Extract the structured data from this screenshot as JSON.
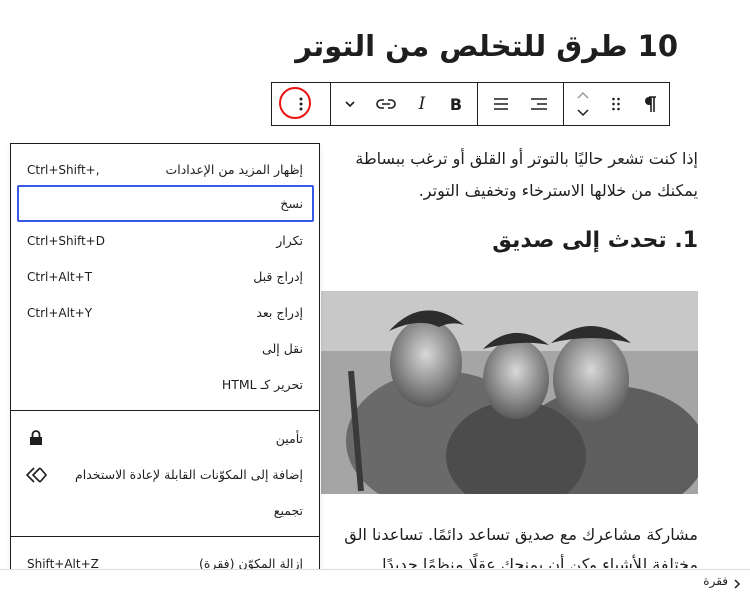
{
  "title": "10 طرق للتخلص من التوتر",
  "toolbar": {
    "paragraph_icon": "paragraph-icon",
    "drag_icon": "drag-handle-icon",
    "move_icon": "move-up-down-icon",
    "align_icon": "align-right-icon",
    "justify_icon": "justify-icon",
    "bold_label": "B",
    "italic_label": "I",
    "link_icon": "link-icon",
    "more_icon": "chevron-down-icon",
    "options_icon": "more-vertical-icon"
  },
  "content": {
    "para1_line1": "إذا كنت تشعر حاليًا بالتوتر أو القلق أو ترغب ببساطة",
    "para1_line2": "يمكنك من خلالها الاسترخاء وتخفيف التوتر.",
    "subheading": "1. تحدث إلى صديق",
    "para2_line1": "مشاركة مشاعرك مع صديق تساعد دائمًا. تساعدنا الق",
    "para2_line2": "مختلفة للأشياء وكن أن يمنحك عقلًا منظمًا جديدًا."
  },
  "menu": {
    "items": [
      {
        "label": "إظهار المزيد من الإعدادات",
        "shortcut": "Ctrl+Shift+,"
      },
      {
        "label": "نسخ",
        "shortcut": ""
      },
      {
        "label": "تكرار",
        "shortcut": "Ctrl+Shift+D"
      },
      {
        "label": "إدراج قبل",
        "shortcut": "Ctrl+Alt+T"
      },
      {
        "label": "إدراج بعد",
        "shortcut": "Ctrl+Alt+Y"
      },
      {
        "label": "نقل إلى",
        "shortcut": ""
      },
      {
        "label": "تحرير كـ HTML",
        "shortcut": ""
      }
    ],
    "group2": [
      {
        "label": "تأمين",
        "icon": "lock-icon"
      },
      {
        "label": "إضافة إلى المكوّنات القابلة لإعادة الاستخدام",
        "icon": "reusable-block-icon"
      },
      {
        "label": "تجميع",
        "icon": ""
      }
    ],
    "group3": [
      {
        "label": "إزالة المكوّن (فقرة)",
        "shortcut": "Shift+Alt+Z"
      }
    ]
  },
  "breadcrumb": {
    "label": "فقرة"
  }
}
